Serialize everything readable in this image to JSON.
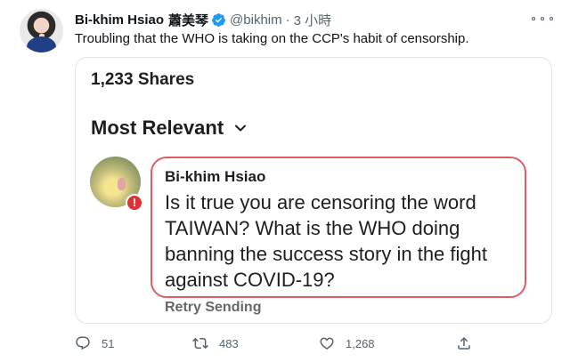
{
  "tweet": {
    "author_name": "Bi-khim Hsiao",
    "author_name_cjk": "蕭美琴",
    "handle": "@bikhim",
    "separator": "·",
    "time": "3 小時",
    "text": "Troubling that the WHO is taking on the CCP's habit of censorship."
  },
  "card": {
    "shares": "1,233 Shares",
    "sort_label": "Most Relevant",
    "comment": {
      "name": "Bi-khim Hsiao",
      "text": "Is it true you are censoring the word TAIWAN?  What is the WHO doing banning the success story in the fight against COVID-19?",
      "alert_glyph": "!",
      "retry": "Retry Sending"
    }
  },
  "actions": {
    "reply_count": "51",
    "retweet_count": "483",
    "like_count": "1,268"
  },
  "colors": {
    "verified": "#1d9bf0",
    "bubble_border": "#e05c62",
    "alert": "#dd3336",
    "muted": "#536471"
  },
  "icons": [
    "verified-badge-icon",
    "more-options-icon",
    "chevron-down-icon",
    "error-alert-icon",
    "reply-icon",
    "retweet-icon",
    "like-icon",
    "share-icon"
  ]
}
